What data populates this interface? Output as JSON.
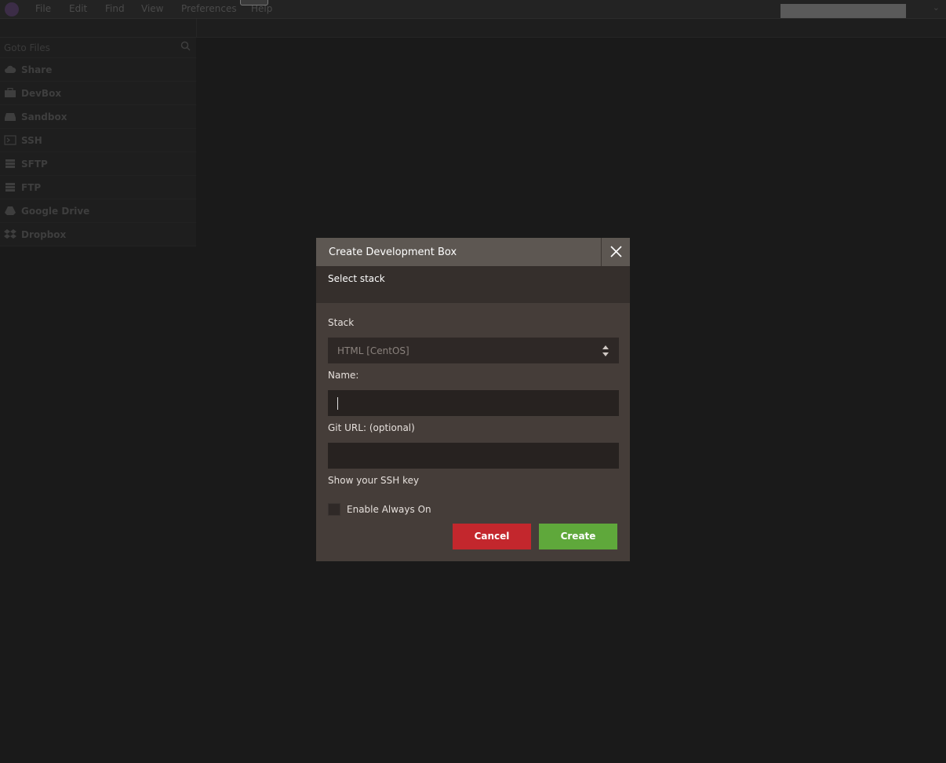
{
  "menubar": {
    "items": [
      "File",
      "Edit",
      "Find",
      "View",
      "Preferences",
      "Help"
    ]
  },
  "sidebar": {
    "goto_placeholder": "Goto Files",
    "items": [
      {
        "label": "Share",
        "icon": "cloud-icon"
      },
      {
        "label": "DevBox",
        "icon": "briefcase-icon"
      },
      {
        "label": "Sandbox",
        "icon": "drive-icon"
      },
      {
        "label": "SSH",
        "icon": "terminal-icon"
      },
      {
        "label": "SFTP",
        "icon": "server-icon"
      },
      {
        "label": "FTP",
        "icon": "server-icon"
      },
      {
        "label": "Google Drive",
        "icon": "google-drive-icon"
      },
      {
        "label": "Dropbox",
        "icon": "dropbox-icon"
      }
    ]
  },
  "modal": {
    "title": "Create Development Box",
    "subtitle": "Select stack",
    "stack_label": "Stack",
    "stack_value": "HTML [CentOS]",
    "name_label": "Name:",
    "name_value": "",
    "git_label": "Git URL: (optional)",
    "git_value": "",
    "ssh_link": "Show your SSH key",
    "always_on_label": "Enable Always On",
    "always_on_checked": false,
    "cancel_label": "Cancel",
    "create_label": "Create"
  },
  "colors": {
    "cancel": "#c3272d",
    "create": "#5fa83b",
    "modal_bg": "#453d39",
    "modal_header": "#5d5752"
  }
}
